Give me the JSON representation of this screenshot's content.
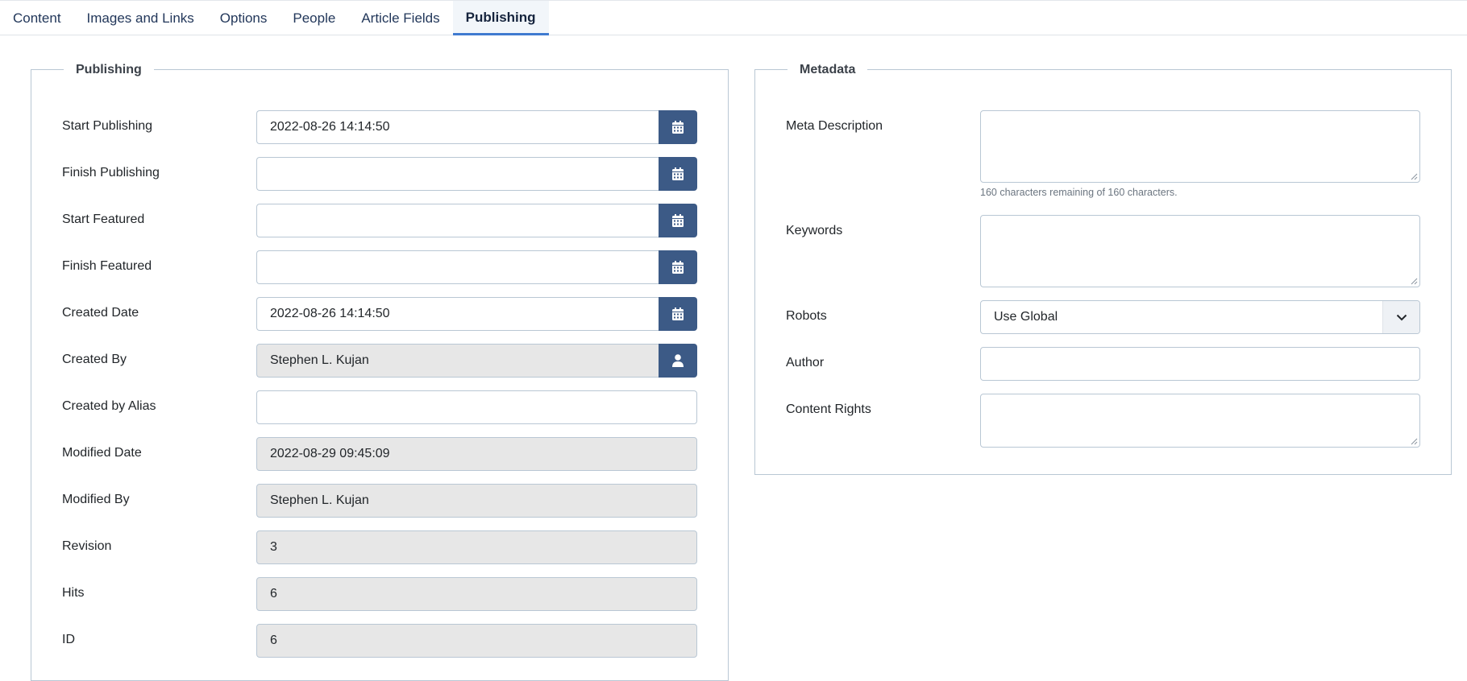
{
  "tabs": [
    {
      "label": "Content"
    },
    {
      "label": "Images and Links"
    },
    {
      "label": "Options"
    },
    {
      "label": "People"
    },
    {
      "label": "Article Fields"
    },
    {
      "label": "Publishing",
      "active": true
    }
  ],
  "publishing": {
    "legend": "Publishing",
    "fields": {
      "start_publishing": {
        "label": "Start Publishing",
        "value": "2022-08-26 14:14:50",
        "icon": "calendar-icon"
      },
      "finish_publishing": {
        "label": "Finish Publishing",
        "value": "",
        "icon": "calendar-icon"
      },
      "start_featured": {
        "label": "Start Featured",
        "value": "",
        "icon": "calendar-icon"
      },
      "finish_featured": {
        "label": "Finish Featured",
        "value": "",
        "icon": "calendar-icon"
      },
      "created_date": {
        "label": "Created Date",
        "value": "2022-08-26 14:14:50",
        "icon": "calendar-icon"
      },
      "created_by": {
        "label": "Created By",
        "value": "Stephen L. Kujan",
        "icon": "user-icon"
      },
      "created_by_alias": {
        "label": "Created by Alias",
        "value": ""
      },
      "modified_date": {
        "label": "Modified Date",
        "value": "2022-08-29 09:45:09"
      },
      "modified_by": {
        "label": "Modified By",
        "value": "Stephen L. Kujan"
      },
      "revision": {
        "label": "Revision",
        "value": "3"
      },
      "hits": {
        "label": "Hits",
        "value": "6"
      },
      "id": {
        "label": "ID",
        "value": "6"
      }
    }
  },
  "metadata": {
    "legend": "Metadata",
    "meta_description": {
      "label": "Meta Description",
      "value": "",
      "hint": "160 characters remaining of 160 characters."
    },
    "keywords": {
      "label": "Keywords",
      "value": ""
    },
    "robots": {
      "label": "Robots",
      "value": "Use Global",
      "icon": "chevron-down-icon"
    },
    "author": {
      "label": "Author",
      "value": ""
    },
    "content_rights": {
      "label": "Content Rights",
      "value": ""
    }
  },
  "colors": {
    "accent": "#3f7ad0",
    "button": "#3c5a86",
    "border": "#b9c7d4",
    "readonly_bg": "#e7e7e7"
  }
}
